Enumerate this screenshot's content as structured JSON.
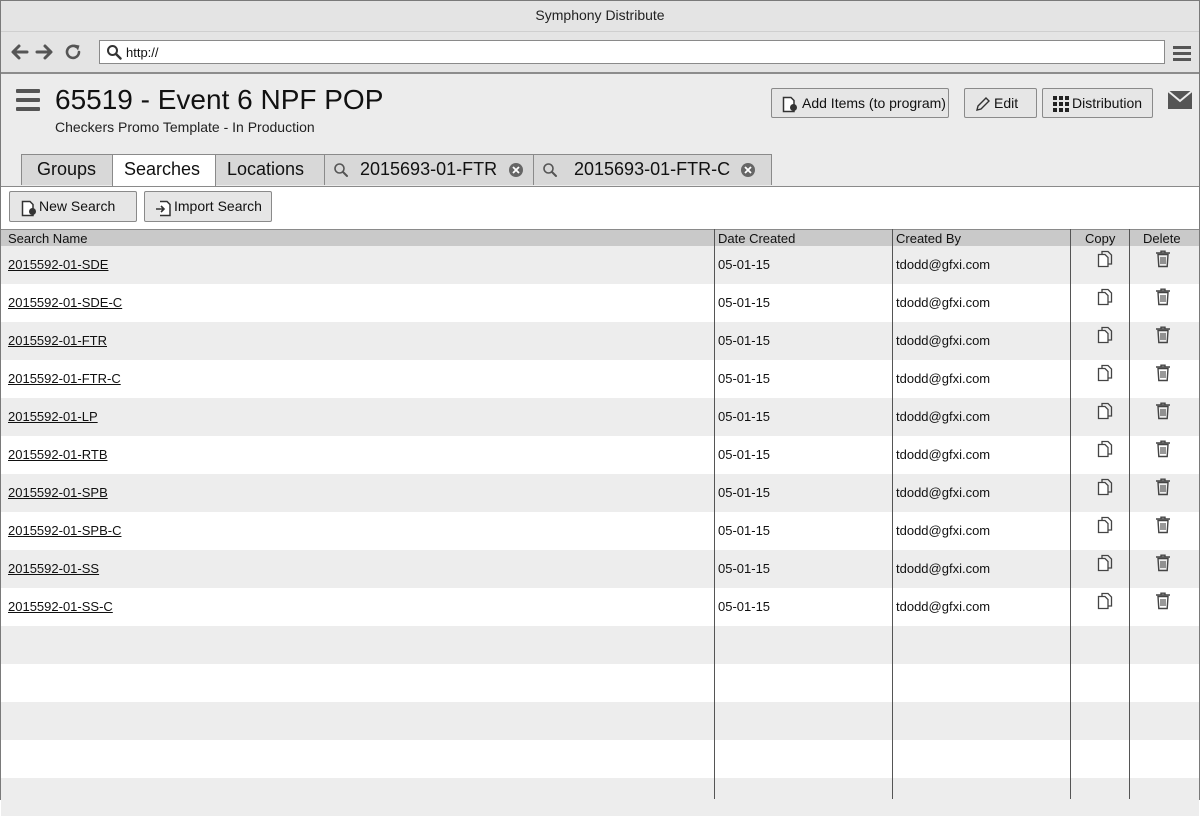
{
  "window": {
    "title": "Symphony Distribute"
  },
  "browser": {
    "url": "http://"
  },
  "header": {
    "title": "65519 - Event 6 NPF POP",
    "subtitle": "Checkers Promo Template - In Production",
    "buttons": {
      "add_items": "Add Items (to program)",
      "edit": "Edit",
      "distribution": "Distribution"
    }
  },
  "tabs": {
    "groups": "Groups",
    "searches": "Searches",
    "locations": "Locations",
    "search_tabs": [
      "2015693-01-FTR",
      "2015693-01-FTR-C"
    ]
  },
  "toolbar": {
    "new_search": "New Search",
    "import_search": "Import Search"
  },
  "table": {
    "columns": {
      "name": "Search Name",
      "date": "Date Created",
      "created_by": "Created By",
      "copy": "Copy",
      "delete": "Delete"
    },
    "rows": [
      {
        "name": "2015592-01-SDE",
        "date": "05-01-15",
        "created_by": "tdodd@gfxi.com"
      },
      {
        "name": "2015592-01-SDE-C",
        "date": "05-01-15",
        "created_by": "tdodd@gfxi.com"
      },
      {
        "name": "2015592-01-FTR",
        "date": "05-01-15",
        "created_by": "tdodd@gfxi.com"
      },
      {
        "name": "2015592-01-FTR-C",
        "date": "05-01-15",
        "created_by": "tdodd@gfxi.com"
      },
      {
        "name": "2015592-01-LP",
        "date": "05-01-15",
        "created_by": "tdodd@gfxi.com"
      },
      {
        "name": "2015592-01-RTB",
        "date": "05-01-15",
        "created_by": "tdodd@gfxi.com"
      },
      {
        "name": "2015592-01-SPB",
        "date": "05-01-15",
        "created_by": "tdodd@gfxi.com"
      },
      {
        "name": "2015592-01-SPB-C",
        "date": "05-01-15",
        "created_by": "tdodd@gfxi.com"
      },
      {
        "name": "2015592-01-SS",
        "date": "05-01-15",
        "created_by": "tdodd@gfxi.com"
      },
      {
        "name": "2015592-01-SS-C",
        "date": "05-01-15",
        "created_by": "tdodd@gfxi.com"
      }
    ]
  }
}
